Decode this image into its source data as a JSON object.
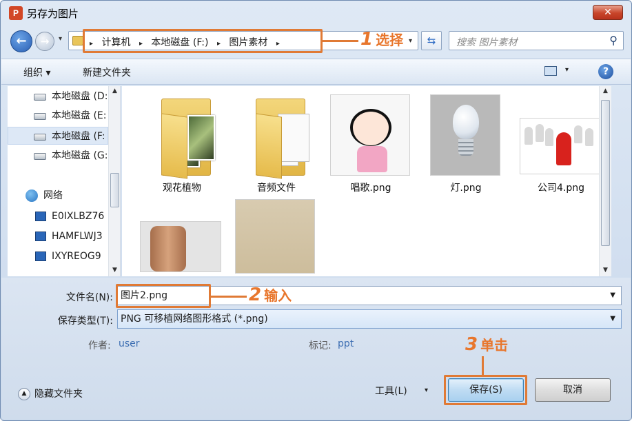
{
  "window": {
    "app_icon_text": "P",
    "title": "另存为图片",
    "close_glyph": "✕"
  },
  "navigation": {
    "back_glyph": "←",
    "forward_glyph": "→",
    "dropdown_glyph": "▾"
  },
  "address": {
    "separator": "▸",
    "crumbs": [
      "计算机",
      "本地磁盘 (F:)",
      "图片素材"
    ],
    "refresh_glyph": "⇆"
  },
  "search": {
    "placeholder": "搜索 图片素材",
    "icon_glyph": "⚲"
  },
  "toolbar": {
    "organize": "组织 ▾",
    "new_folder": "新建文件夹",
    "view_drop": "▾",
    "help": "?"
  },
  "nav_pane": {
    "items": [
      {
        "label": "本地磁盘 (D:",
        "icon": "drive-icon"
      },
      {
        "label": "本地磁盘 (E:",
        "icon": "drive-icon"
      },
      {
        "label": "本地磁盘 (F:",
        "icon": "drive-icon",
        "selected": true
      },
      {
        "label": "本地磁盘 (G:",
        "icon": "drive-icon"
      },
      {
        "label": "网络",
        "icon": "network-icon"
      },
      {
        "label": "E0IXLBZ76",
        "icon": "computer-icon"
      },
      {
        "label": "HAMFLWJ3",
        "icon": "computer-icon"
      },
      {
        "label": "IXYREOG9",
        "icon": "computer-icon"
      }
    ]
  },
  "files": [
    {
      "label": "观花植物",
      "kind": "folder-photo"
    },
    {
      "label": "音频文件",
      "kind": "folder-doc"
    },
    {
      "label": "唱歌.png",
      "kind": "cartoon"
    },
    {
      "label": "灯.png",
      "kind": "bulb"
    },
    {
      "label": "公司4.png",
      "kind": "crowd"
    },
    {
      "label": "",
      "kind": "waist"
    },
    {
      "label": "",
      "kind": "painting"
    }
  ],
  "form": {
    "filename_label": "文件名(N):",
    "filename_value": "图片2.png",
    "filetype_label": "保存类型(T):",
    "filetype_value": "PNG 可移植网络图形格式 (*.png)",
    "author_label": "作者:",
    "author_value": "user",
    "tags_label": "标记:",
    "tags_value": "ppt",
    "hide_folders": "隐藏文件夹",
    "hide_glyph": "▲",
    "tools": "工具(L)",
    "tools_drop": "▾",
    "save": "保存(S)",
    "cancel": "取消"
  },
  "annotations": {
    "step1_num": "1",
    "step1_text": "选择",
    "step2_num": "2",
    "step2_text": "输入",
    "step3_num": "3",
    "step3_text": "单击",
    "color": "#e07a35"
  }
}
